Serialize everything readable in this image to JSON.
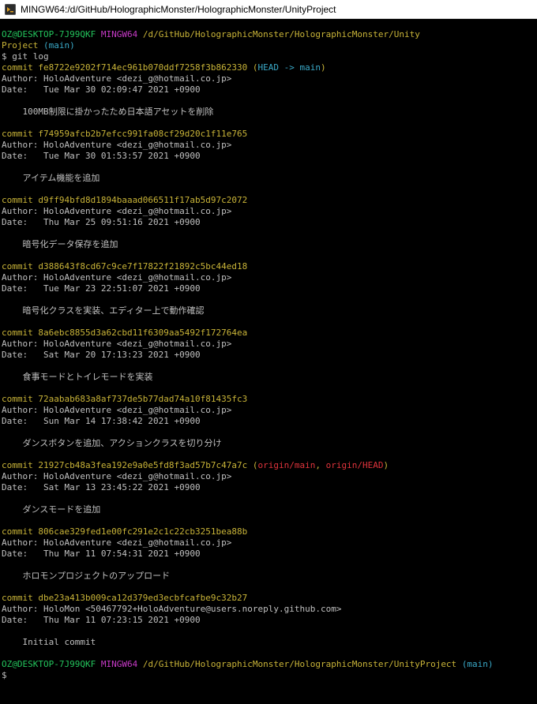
{
  "window": {
    "title": "MINGW64:/d/GitHub/HolographicMonster/HolographicMonster/UnityProject"
  },
  "prompt1": {
    "user": "OZ@DESKTOP-7J99QKF",
    "env": "MINGW64",
    "path": "/d/GitHub/HolographicMonster/HolographicMonster/Unity",
    "path2": "Project",
    "branch": "(main)"
  },
  "command": "$ git log",
  "commits": [
    {
      "hash": "commit fe8722e9202f714ec961b070ddf7258f3b862330",
      "refs_open": "(",
      "head": "HEAD -> main",
      "refs_close": ")",
      "author": "Author: HoloAdventure <dezi_g@hotmail.co.jp>",
      "date": "Date:   Tue Mar 30 02:09:47 2021 +0900",
      "message": "    100MB制限に掛かったため日本語アセットを削除"
    },
    {
      "hash": "commit f74959afcb2b7efcc991fa08cf29d20c1f11e765",
      "author": "Author: HoloAdventure <dezi_g@hotmail.co.jp>",
      "date": "Date:   Tue Mar 30 01:53:57 2021 +0900",
      "message": "    アイテム機能を追加"
    },
    {
      "hash": "commit d9ff94bfd8d1894baaad066511f17ab5d97c2072",
      "author": "Author: HoloAdventure <dezi_g@hotmail.co.jp>",
      "date": "Date:   Thu Mar 25 09:51:16 2021 +0900",
      "message": "    暗号化データ保存を追加"
    },
    {
      "hash": "commit d388643f8cd67c9ce7f17822f21892c5bc44ed18",
      "author": "Author: HoloAdventure <dezi_g@hotmail.co.jp>",
      "date": "Date:   Tue Mar 23 22:51:07 2021 +0900",
      "message": "    暗号化クラスを実装、エディター上で動作確認"
    },
    {
      "hash": "commit 8a6ebc8855d3a62cbd11f6309aa5492f172764ea",
      "author": "Author: HoloAdventure <dezi_g@hotmail.co.jp>",
      "date": "Date:   Sat Mar 20 17:13:23 2021 +0900",
      "message": "    食事モードとトイレモードを実装"
    },
    {
      "hash": "commit 72aabab683a8af737de5b77dad74a10f81435fc3",
      "author": "Author: HoloAdventure <dezi_g@hotmail.co.jp>",
      "date": "Date:   Sun Mar 14 17:38:42 2021 +0900",
      "message": "    ダンスボタンを追加、アクションクラスを切り分け"
    },
    {
      "hash": "commit 21927cb48a3fea192e9a0e5fd8f3ad57b7c47a7c",
      "refs_open": "(",
      "origin_main": "origin/main",
      "sep": ", ",
      "origin_head": "origin/HEAD",
      "refs_close": ")",
      "author": "Author: HoloAdventure <dezi_g@hotmail.co.jp>",
      "date": "Date:   Sat Mar 13 23:45:22 2021 +0900",
      "message": "    ダンスモードを追加"
    },
    {
      "hash": "commit 806cae329fed1e00fc291e2c1c22cb3251bea88b",
      "author": "Author: HoloAdventure <dezi_g@hotmail.co.jp>",
      "date": "Date:   Thu Mar 11 07:54:31 2021 +0900",
      "message": "    ホロモンプロジェクトのアップロード"
    },
    {
      "hash": "commit dbe23a413b009ca12d379ed3ecbfcafbe9c32b27",
      "author": "Author: HoloMon <50467792+HoloAdventure@users.noreply.github.com>",
      "date": "Date:   Thu Mar 11 07:23:15 2021 +0900",
      "message": "    Initial commit"
    }
  ],
  "prompt2": {
    "user": "OZ@DESKTOP-7J99QKF",
    "env": "MINGW64",
    "path": "/d/GitHub/HolographicMonster/HolographicMonster/UnityProject",
    "branch": "(main)"
  },
  "final_prompt": "$",
  "colors": {
    "green": "#23c45c",
    "magenta": "#c63ac6",
    "yellow": "#c9b438",
    "cyan": "#3aa9c8",
    "red": "#e0343c",
    "text": "#c0c0c0"
  },
  "icons": {
    "app": "mingw-terminal-icon"
  }
}
